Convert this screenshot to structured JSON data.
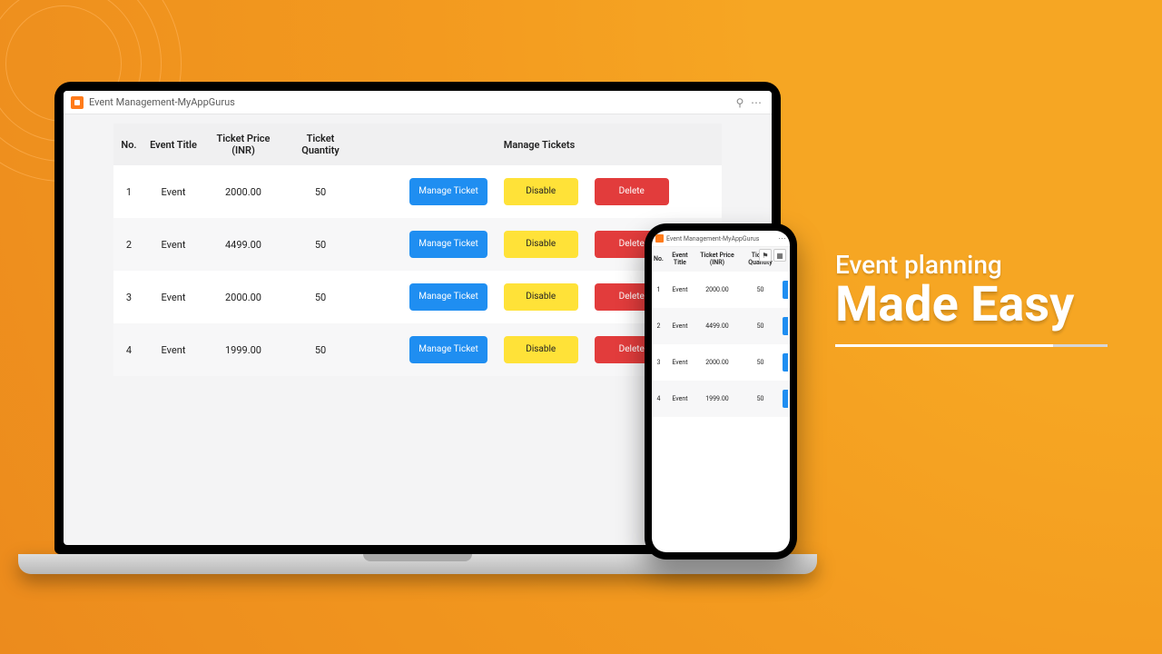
{
  "headline": {
    "line1": "Event planning",
    "line2": "Made Easy"
  },
  "window": {
    "title": "Event Management-MyAppGurus"
  },
  "phone_window": {
    "title": "Event Management-MyAppGurus"
  },
  "table": {
    "headers": {
      "no": "No.",
      "title": "Event Title",
      "price": "Ticket Price (INR)",
      "qty": "Ticket Quantity",
      "manage": "Manage Tickets"
    },
    "buttons": {
      "manage": "Manage Ticket",
      "disable": "Disable",
      "delete": "Delete"
    },
    "rows": [
      {
        "no": "1",
        "title": "Event",
        "price": "2000.00",
        "qty": "50"
      },
      {
        "no": "2",
        "title": "Event",
        "price": "4499.00",
        "qty": "50"
      },
      {
        "no": "3",
        "title": "Event",
        "price": "2000.00",
        "qty": "50"
      },
      {
        "no": "4",
        "title": "Event",
        "price": "1999.00",
        "qty": "50"
      }
    ]
  },
  "phone_table": {
    "headers": {
      "no": "No.",
      "title": "Event Title",
      "price": "Ticket Price (INR)",
      "qty": "Ticket Quantity"
    },
    "rows": [
      {
        "no": "1",
        "title": "Event",
        "price": "2000.00",
        "qty": "50"
      },
      {
        "no": "2",
        "title": "Event",
        "price": "4499.00",
        "qty": "50"
      },
      {
        "no": "3",
        "title": "Event",
        "price": "2000.00",
        "qty": "50"
      },
      {
        "no": "4",
        "title": "Event",
        "price": "1999.00",
        "qty": "50"
      }
    ]
  },
  "colors": {
    "primary": "#1f8ef1",
    "warn": "#ffe238",
    "danger": "#e23c3c",
    "brand": "#ff7b1a"
  }
}
